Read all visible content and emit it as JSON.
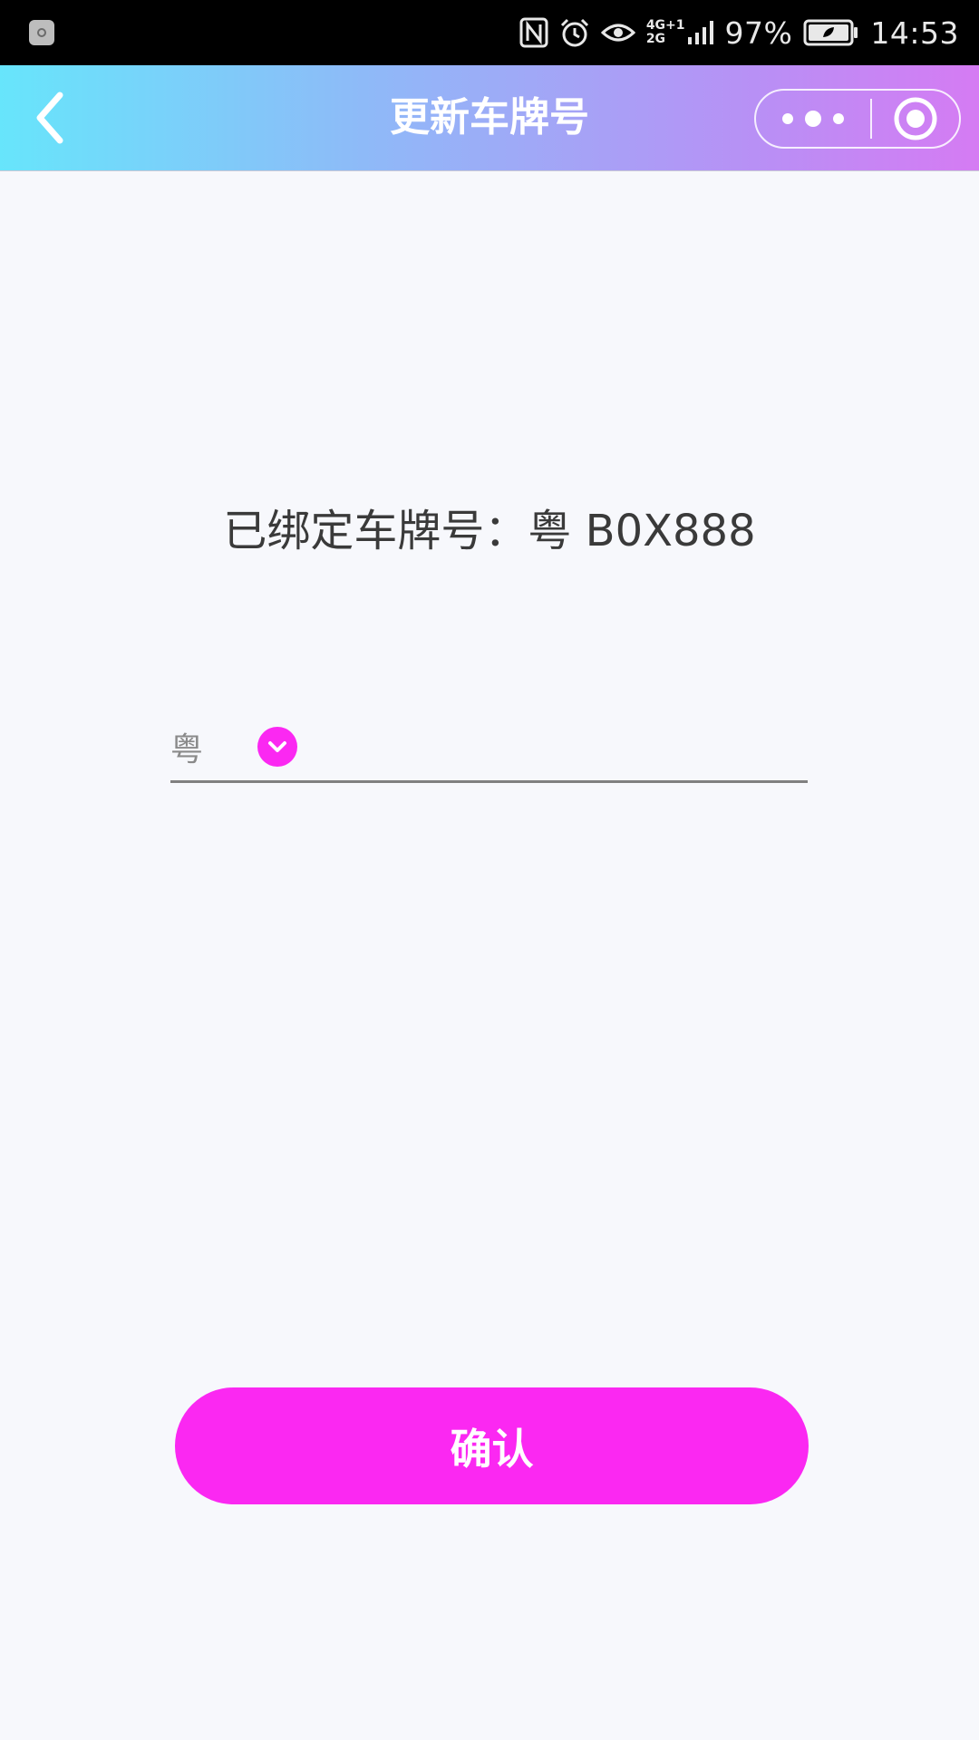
{
  "status_bar": {
    "battery_percent": "97%",
    "time": "14:53",
    "network_top": "4G+1",
    "network_bottom": "2G",
    "icons": [
      "app-notification-icon",
      "nfc-icon",
      "alarm-icon",
      "eye-comfort-icon",
      "signal-icon",
      "battery-icon"
    ]
  },
  "nav": {
    "title": "更新车牌号",
    "back_icon": "chevron-left-icon",
    "more_icon": "more-dots-icon",
    "close_icon": "target-close-icon"
  },
  "content": {
    "bound_plate_text": "已绑定车牌号：粤 B0X888",
    "province": "粤",
    "plate_input_value": "",
    "plate_input_placeholder": ""
  },
  "actions": {
    "confirm_label": "确认"
  },
  "colors": {
    "accent": "#fb28f2",
    "nav_gradient_start": "#67e5fb",
    "nav_gradient_end": "#d57bf3",
    "background": "#f7f8fc"
  }
}
